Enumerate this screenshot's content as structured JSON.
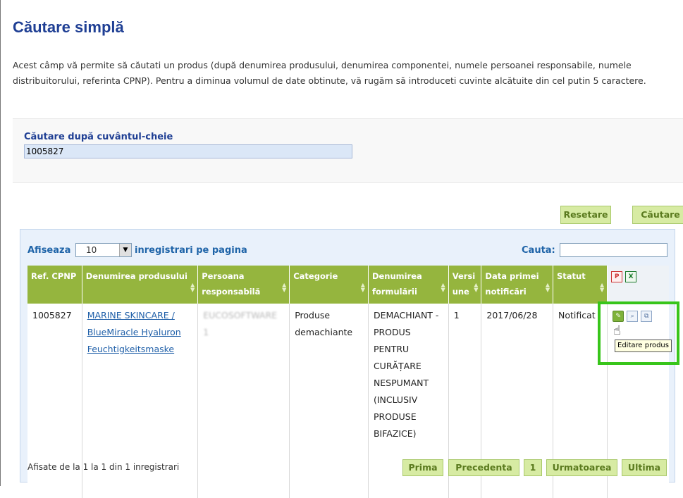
{
  "page": {
    "title": "Căutare simplă",
    "intro": "Acest câmp vă permite să căutati un produs (după denumirea produsului, denumirea componentei, numele persoanei responsabile, numele distribuitorului, referinta CPNP). Pentru a diminua volumul de date obtinute, vă rugăm să introduceti cuvinte alcătuite din cel putin 5 caractere."
  },
  "search": {
    "label": "Căutare după cuvântul-cheie",
    "value": "1005827",
    "reset_label": "Resetare",
    "search_label": "Căutare"
  },
  "results": {
    "show_label": "Afiseaza",
    "page_size": "10",
    "per_page_label": "inregistrari pe pagina",
    "filter_label": "Cauta:",
    "columns": [
      "Ref. CPNP",
      "Denumirea produsului",
      "Persoana responsabilă",
      "Categorie",
      "Denumirea formulării",
      "Versi une",
      "Data primei notificări",
      "Statut"
    ],
    "rows": [
      {
        "ref": "1005827",
        "product_lines": [
          "MARINE SKINCARE /",
          "BlueMiracle Hyaluron",
          "Feuchtigkeitsmaske"
        ],
        "person": "EUCOSOFTWARE 1",
        "category": "Produse demachiante",
        "formulation": "DEMACHIANT - PRODUS PENTRU CURĂȚARE NESPUMANT (INCLUSIV PRODUSE BIFAZICE)",
        "version": "1",
        "date": "2017/06/28",
        "status": "Notificat"
      }
    ],
    "tooltip": "Editare produs",
    "footer_info": "Afisate de la 1 la 1 din 1 inregistrari",
    "pager": {
      "first": "Prima",
      "prev": "Precedenta",
      "current": "1",
      "next": "Urmatoarea",
      "last": "Ultima"
    }
  },
  "icons": {
    "export_pdf": "pdf-icon",
    "export_excel": "excel-icon",
    "edit": "edit-icon",
    "view": "view-icon",
    "copy": "copy-icon"
  },
  "colors": {
    "title": "#1f3f94",
    "header_green": "#95b53e",
    "button_green": "#d7eba3",
    "highlight": "#38c51a"
  }
}
